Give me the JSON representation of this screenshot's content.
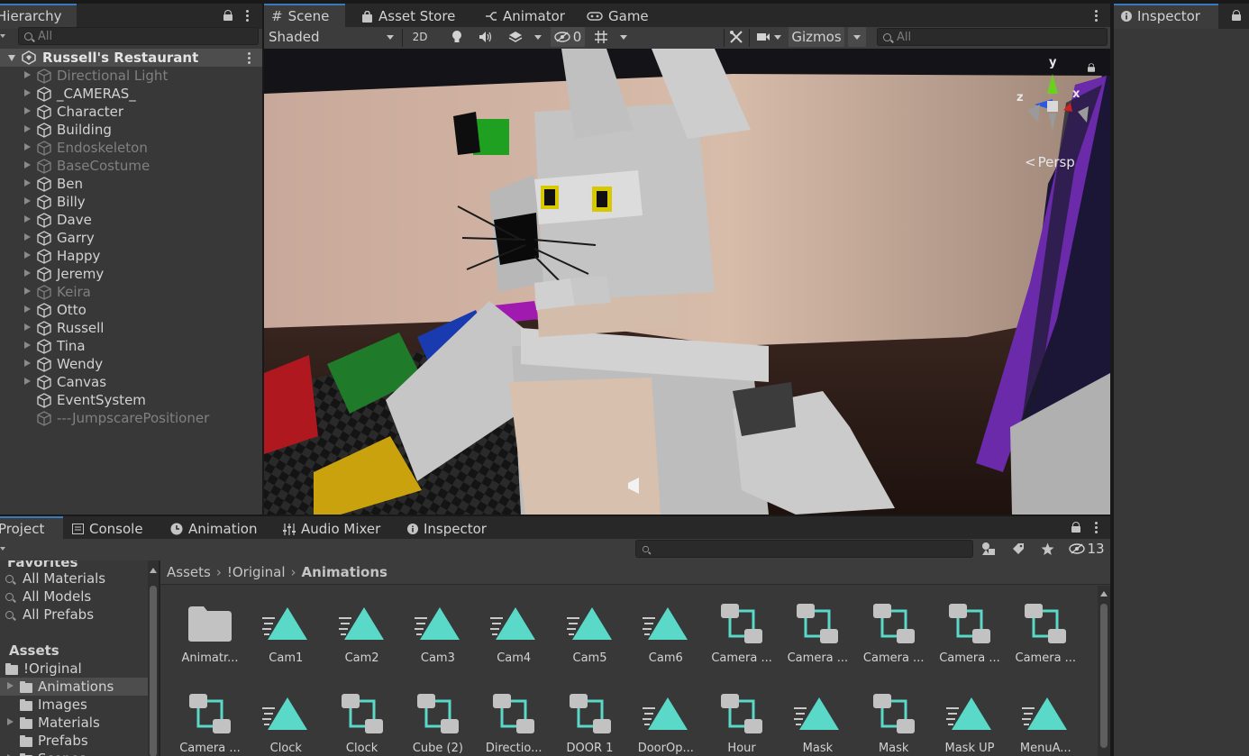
{
  "hierarchy": {
    "tab_label": "Hierarchy",
    "search_placeholder": "All",
    "scene_name": "Russell's Restaurant",
    "items": [
      {
        "label": "Directional Light",
        "dim": true
      },
      {
        "label": "_CAMERAS_",
        "dim": false
      },
      {
        "label": "Character",
        "dim": false
      },
      {
        "label": "Building",
        "dim": false
      },
      {
        "label": "Endoskeleton",
        "dim": true
      },
      {
        "label": "BaseCostume",
        "dim": true
      },
      {
        "label": "Ben",
        "dim": false
      },
      {
        "label": "Billy",
        "dim": false
      },
      {
        "label": "Dave",
        "dim": false
      },
      {
        "label": "Garry",
        "dim": false
      },
      {
        "label": "Happy",
        "dim": false
      },
      {
        "label": "Jeremy",
        "dim": false
      },
      {
        "label": "Keira",
        "dim": true
      },
      {
        "label": "Otto",
        "dim": false
      },
      {
        "label": "Russell",
        "dim": false
      },
      {
        "label": "Tina",
        "dim": false
      },
      {
        "label": "Wendy",
        "dim": false
      },
      {
        "label": "Canvas",
        "dim": false
      },
      {
        "label": "EventSystem",
        "dim": false
      },
      {
        "label": "---JumpscarePositioner",
        "dim": true
      }
    ]
  },
  "top_tabs": {
    "scene": "Scene",
    "asset_store": "Asset Store",
    "animator": "Animator",
    "game": "Game"
  },
  "scene_toolbar": {
    "draw_mode": "Shaded",
    "mode_2d": "2D",
    "hidden_count": "0",
    "gizmos": "Gizmos",
    "search_placeholder": "All",
    "persp_label": "Persp",
    "axis_x": "x",
    "axis_y": "y",
    "axis_z": "z"
  },
  "inspector": {
    "tab_label": "Inspector"
  },
  "bottom_tabs": {
    "project": "Project",
    "console": "Console",
    "animation": "Animation",
    "audio_mixer": "Audio Mixer",
    "inspector": "Inspector"
  },
  "project": {
    "hidden_count": "13",
    "sidebar": {
      "favorites_label": "Favorites",
      "favorites": [
        "All Materials",
        "All Models",
        "All Prefabs"
      ],
      "assets_label": "Assets",
      "tree": [
        {
          "label": "!Original",
          "indent": 0,
          "expanded": true
        },
        {
          "label": "Animations",
          "indent": 1,
          "selected": true
        },
        {
          "label": "Images",
          "indent": 1
        },
        {
          "label": "Materials",
          "indent": 1
        },
        {
          "label": "Prefabs",
          "indent": 1
        },
        {
          "label": "Scenes",
          "indent": 1
        }
      ]
    },
    "breadcrumb": [
      "Assets",
      "!Original",
      "Animations"
    ],
    "assets": [
      {
        "name": "Animatr...",
        "type": "folder"
      },
      {
        "name": "Cam1",
        "type": "clip"
      },
      {
        "name": "Cam2",
        "type": "clip"
      },
      {
        "name": "Cam3",
        "type": "clip"
      },
      {
        "name": "Cam4",
        "type": "clip"
      },
      {
        "name": "Cam5",
        "type": "clip"
      },
      {
        "name": "Cam6",
        "type": "clip"
      },
      {
        "name": "Camera ...",
        "type": "controller"
      },
      {
        "name": "Camera ...",
        "type": "controller"
      },
      {
        "name": "Camera ...",
        "type": "controller"
      },
      {
        "name": "Camera ...",
        "type": "controller"
      },
      {
        "name": "Camera ...",
        "type": "controller"
      },
      {
        "name": "Camera ...",
        "type": "controller"
      },
      {
        "name": "Clock",
        "type": "clip"
      },
      {
        "name": "Clock",
        "type": "controller"
      },
      {
        "name": "Cube (2)",
        "type": "controller"
      },
      {
        "name": "Directio...",
        "type": "controller"
      },
      {
        "name": "DOOR 1",
        "type": "controller"
      },
      {
        "name": "DoorOp...",
        "type": "clip"
      },
      {
        "name": "Hour",
        "type": "controller"
      },
      {
        "name": "Mask",
        "type": "clip"
      },
      {
        "name": "Mask",
        "type": "controller"
      },
      {
        "name": "Mask UP",
        "type": "clip"
      },
      {
        "name": "MenuA...",
        "type": "clip"
      }
    ]
  },
  "colors": {
    "accent": "#3a79bb",
    "clip_icon": "#5ad8c8",
    "panel_bg": "#383838",
    "tab_bar": "#282828"
  }
}
